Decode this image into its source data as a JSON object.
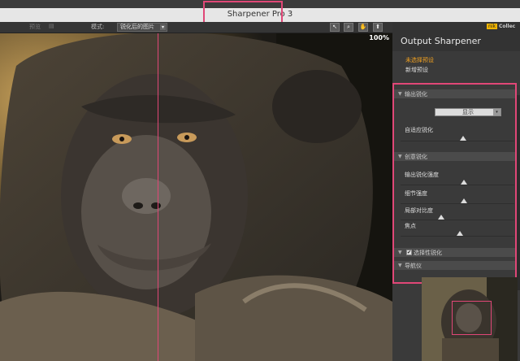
{
  "window": {
    "title": "Sharpener Pro 3"
  },
  "toolbar": {
    "preview_label": "预览",
    "mode_label": "模式:",
    "mode_value": "锐化后的图片",
    "tools": [
      "arrow-icon",
      "zoom-icon",
      "hand-icon",
      "pin-icon"
    ]
  },
  "canvas": {
    "zoom": "100%"
  },
  "panel": {
    "title": "Output Sharpener",
    "brand": "Collec",
    "presets": {
      "unselected": "未选择预设",
      "new": "新增预设"
    },
    "sections": {
      "output_sharpening": "输出锐化",
      "display_option": "显示",
      "adaptive_label": "自适应锐化",
      "creative_sharpening": "创意锐化",
      "sliders": [
        {
          "label": "输出锐化强度",
          "value": 0.56
        },
        {
          "label": "细节强度",
          "value": 0.56
        },
        {
          "label": "局部对比度",
          "value": 0.36
        },
        {
          "label": "焦点",
          "value": 0.52
        }
      ],
      "adaptive_value": 0.55,
      "selective_sharpening": "选择性锐化",
      "selective_checked": true,
      "navigator": "导航仪"
    }
  },
  "colors": {
    "highlight": "#e04777",
    "preset_active": "#f0a020"
  }
}
